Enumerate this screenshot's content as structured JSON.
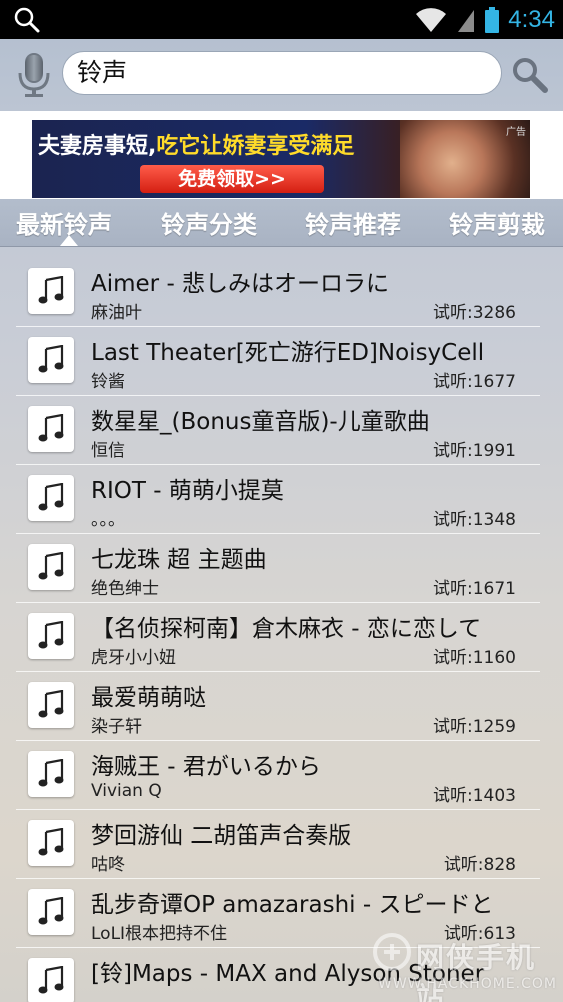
{
  "status_bar": {
    "time": "4:34"
  },
  "search": {
    "value": "铃声"
  },
  "ad": {
    "headline_part1": "夫妻房事短,",
    "headline_part2": "吃它让娇妻享受满足",
    "cta": "免费领取>>",
    "tag": "广告"
  },
  "tabs": [
    {
      "label": "最新铃声",
      "active": true
    },
    {
      "label": "铃声分类"
    },
    {
      "label": "铃声推荐"
    },
    {
      "label": "铃声剪裁"
    }
  ],
  "songs": [
    {
      "title": "Aimer - 悲しみはオーロラに",
      "artist": "麻油叶",
      "plays": "试听:3286"
    },
    {
      "title": "Last Theater[死亡游行ED]NoisyCell",
      "artist": "铃酱",
      "plays": "试听:1677"
    },
    {
      "title": "数星星_(Bonus童音版)-儿童歌曲",
      "artist": "恒信",
      "plays": "试听:1991"
    },
    {
      "title": "RIOT - 萌萌小提莫",
      "artist": "。。。",
      "plays": "试听:1348"
    },
    {
      "title": "七龙珠 超 主题曲",
      "artist": "绝色绅士",
      "plays": "试听:1671"
    },
    {
      "title": "【名侦探柯南】倉木麻衣 - 恋に恋して",
      "artist": "虎牙小小妞",
      "plays": "试听:1160"
    },
    {
      "title": "最爱萌萌哒",
      "artist": "染子轩",
      "plays": "试听:1259"
    },
    {
      "title": "海贼王 - 君がいるから",
      "artist": "Vivian Q",
      "plays": "试听:1403"
    },
    {
      "title": "梦回游仙 二胡笛声合奏版",
      "artist": "咕咚",
      "plays": "试听:828"
    },
    {
      "title": "乱步奇谭OP amazarashi - スピードと",
      "artist": "LoLI根本把持不住",
      "plays": "试听:613"
    },
    {
      "title": "[铃]Maps - MAX and Alyson Stoner",
      "artist": "",
      "plays": ""
    }
  ],
  "watermark": {
    "text": "网侠手机站",
    "url": "WWW.HACKHOME.COM"
  },
  "colors": {
    "accent": "#34b5e5",
    "ad_highlight": "#ffdb2a",
    "cta": "#d41f12"
  }
}
